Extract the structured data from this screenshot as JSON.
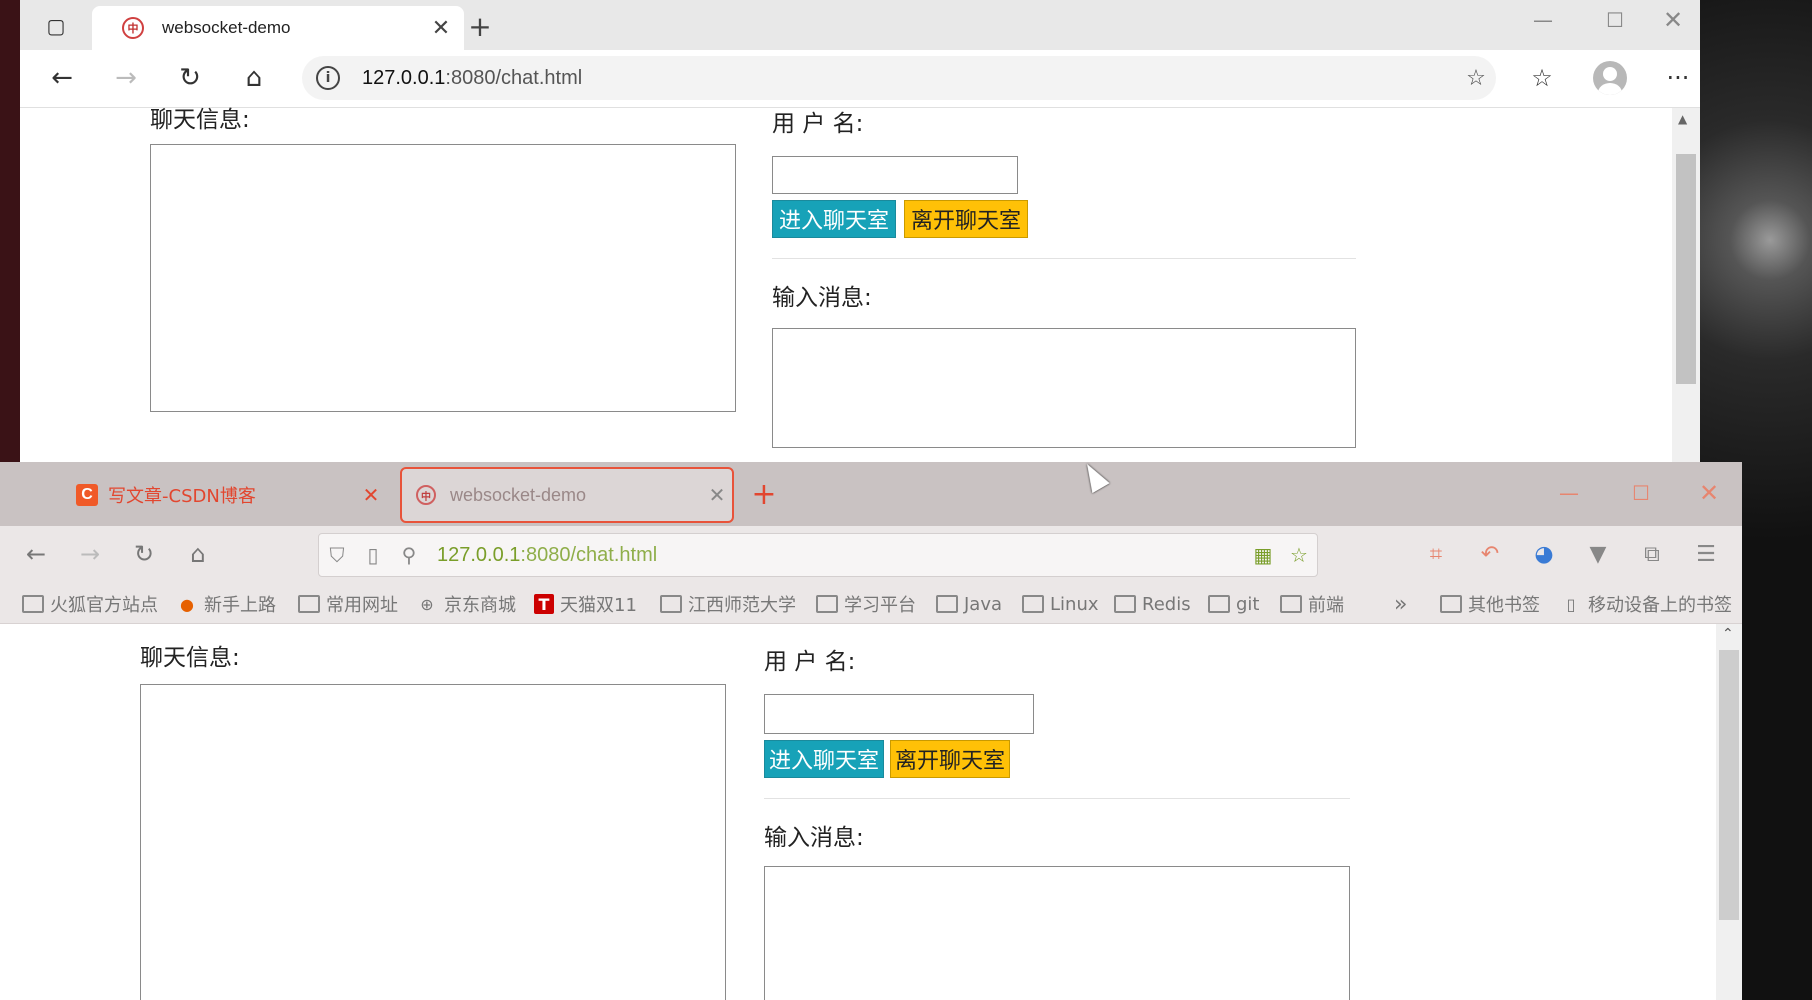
{
  "back_window": {
    "tab_title": "websocket-demo",
    "url_host": "127.0.0.1",
    "url_path": ":8080/chat.html",
    "page": {
      "chat_label": "聊天信息:",
      "username_label": "用 户 名:",
      "enter_button": "进入聊天室",
      "leave_button": "离开聊天室",
      "message_label": "输入消息:",
      "username_value": "",
      "message_value": ""
    }
  },
  "front_window": {
    "tabs": [
      {
        "title": "写文章-CSDN博客",
        "favicon_letter": "C"
      },
      {
        "title": "websocket-demo"
      }
    ],
    "url_host": "127.0.0.1",
    "url_path": ":8080/chat.html",
    "bookmarks": [
      {
        "label": "火狐官方站点",
        "icon": "folder-icon"
      },
      {
        "label": "新手上路",
        "icon": "firefox-icon"
      },
      {
        "label": "常用网址",
        "icon": "folder-icon"
      },
      {
        "label": "京东商城",
        "icon": "globe-icon"
      },
      {
        "label": "天猫双11",
        "icon": "tmall-icon"
      },
      {
        "label": "江西师范大学",
        "icon": "folder-icon"
      },
      {
        "label": "学习平台",
        "icon": "folder-icon"
      },
      {
        "label": "Java",
        "icon": "folder-icon"
      },
      {
        "label": "Linux",
        "icon": "folder-icon"
      },
      {
        "label": "Redis",
        "icon": "folder-icon"
      },
      {
        "label": "git",
        "icon": "folder-icon"
      },
      {
        "label": "前端",
        "icon": "folder-icon"
      }
    ],
    "other_bookmarks": "其他书签",
    "mobile_bookmarks": "移动设备上的书签",
    "page": {
      "chat_label": "聊天信息:",
      "username_label": "用 户 名:",
      "enter_button": "进入聊天室",
      "leave_button": "离开聊天室",
      "message_label": "输入消息:",
      "username_value": "",
      "message_value": ""
    }
  },
  "colors": {
    "enter_button": "#17a2b8",
    "leave_button": "#ffc107",
    "firefox_accent": "#e2462f",
    "url_green": "#7a9e2a"
  }
}
